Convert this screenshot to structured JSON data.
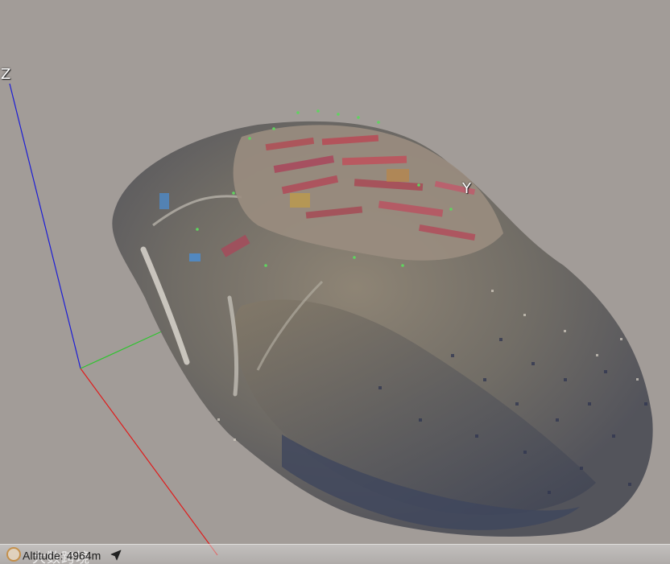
{
  "viewer": {
    "axes": {
      "z_label": "Z",
      "y_label": "Y",
      "x_color": "#e01b1b",
      "y_color": "#2fc42f",
      "z_color": "#1c1cd6"
    },
    "background_color": "#a29c98",
    "status_bar": {
      "altitude_label": "Altitude:",
      "altitude_value": "4964m",
      "navigate_icon": "navigate-arrow-icon",
      "watermark_text": "大数跨境"
    },
    "model": {
      "description_icon": "point-cloud-model"
    }
  }
}
